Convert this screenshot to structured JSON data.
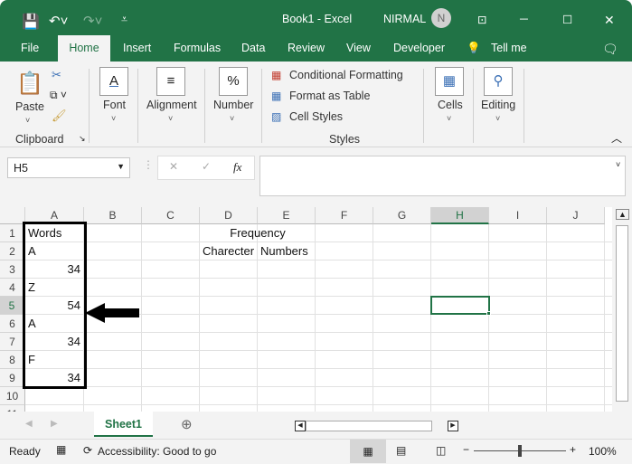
{
  "titlebar": {
    "doc_title": "Book1  -  Excel",
    "user": "NIRMAL",
    "avatar_initial": "N"
  },
  "tabs": [
    "File",
    "Home",
    "Insert",
    "Formulas",
    "Data",
    "Review",
    "View",
    "Developer"
  ],
  "tell_me": "Tell me",
  "ribbon": {
    "paste": "Paste",
    "clipboard": "Clipboard",
    "font": "Font",
    "alignment": "Alignment",
    "number": "Number",
    "number_icon": "%",
    "conditional": "Conditional Formatting",
    "format_table": "Format as Table",
    "cell_styles": "Cell Styles",
    "styles": "Styles",
    "cells": "Cells",
    "editing": "Editing"
  },
  "formula_bar": {
    "name_box": "H5",
    "fx": "fx",
    "cancel": "✕",
    "enter": "✓",
    "value": ""
  },
  "columns": [
    "A",
    "B",
    "C",
    "D",
    "E",
    "F",
    "G",
    "H",
    "I",
    "J"
  ],
  "rows": [
    "1",
    "2",
    "3",
    "4",
    "5",
    "6",
    "7",
    "8",
    "9",
    "10",
    "11"
  ],
  "cells": {
    "A1": "Words",
    "A2": "A",
    "A3": "34",
    "A4": "Z",
    "A5": "54",
    "A6": "A",
    "A7": "34",
    "A8": "F",
    "A9": "34",
    "D1": "Frequency",
    "D2": "Charecter",
    "E2": "Numbers"
  },
  "sheet_tab": "Sheet1",
  "status": {
    "ready": "Ready",
    "accessibility": "Accessibility: Good to go",
    "zoom": "100%"
  },
  "colors": {
    "excel_green": "#217346"
  }
}
